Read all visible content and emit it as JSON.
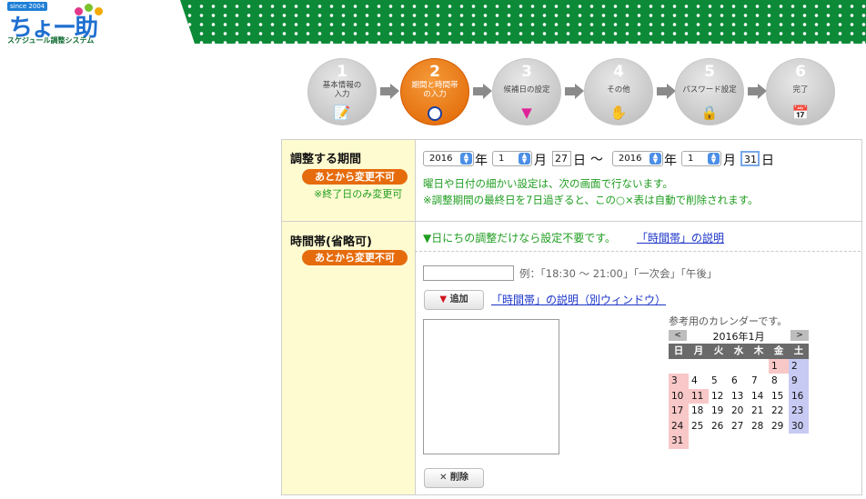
{
  "header": {
    "since": "since 2004",
    "logo_text": "ちょー助",
    "logo_sub": "スケジュール調整システム"
  },
  "steps": [
    {
      "num": "1",
      "label": "基本情報の入力",
      "icon": "document-icon",
      "active": false
    },
    {
      "num": "2",
      "label": "期間と時間帯の入力",
      "icon": "clock-icon",
      "active": true
    },
    {
      "num": "3",
      "label": "候補日の設定",
      "icon": "marker-icon",
      "active": false
    },
    {
      "num": "4",
      "label": "その他",
      "icon": "hand-icon",
      "active": false
    },
    {
      "num": "5",
      "label": "パスワード設定",
      "icon": "lock-icon",
      "active": false
    },
    {
      "num": "6",
      "label": "完了",
      "icon": "calendar-check-icon",
      "active": false
    }
  ],
  "period": {
    "label": "調整する期間",
    "badge": "あとから変更不可",
    "note_end_only": "※終了日のみ変更可",
    "start_year": "2016",
    "year_char": "年",
    "start_month": "1",
    "month_char": "月",
    "start_day": "27",
    "day_char": "日",
    "tilde": "〜",
    "end_year": "2016",
    "end_month": "1",
    "end_day": "31",
    "info1": "曜日や日付の細かい設定は、次の画面で行ないます。",
    "info2": "※調整期間の最終日を7日過ぎると、この○×表は自動で削除されます。"
  },
  "timeslot": {
    "label": "時間帯(省略可)",
    "badge": "あとから変更不可",
    "hint": "▼日にちの調整だけなら設定不要です。",
    "hint_link": "「時間帯」の説明",
    "example": "例：「18:30 〜 21:00」「一次会」「午後」",
    "add_label": "▼ 追加",
    "help_link": "「時間帯」の説明（別ウィンドウ）",
    "delete_label": "✕ 削除",
    "input_value": ""
  },
  "calendar": {
    "caption": "参考用のカレンダーです。",
    "prev": "<",
    "next": ">",
    "month": "2016年1月",
    "weekdays": [
      "日",
      "月",
      "火",
      "水",
      "木",
      "金",
      "土"
    ],
    "weeks": [
      [
        "",
        "",
        "",
        "",
        "",
        "1",
        "2"
      ],
      [
        "3",
        "4",
        "5",
        "6",
        "7",
        "8",
        "9"
      ],
      [
        "10",
        "11",
        "12",
        "13",
        "14",
        "15",
        "16"
      ],
      [
        "17",
        "18",
        "19",
        "20",
        "21",
        "22",
        "23"
      ],
      [
        "24",
        "25",
        "26",
        "27",
        "28",
        "29",
        "30"
      ],
      [
        "31",
        "",
        "",
        "",
        "",
        "",
        ""
      ]
    ],
    "holidays": [
      "1",
      "11"
    ],
    "colors": {
      "sunday": "#f8c7c7",
      "saturday": "#c7caf3",
      "header": "#6a6a6a"
    }
  },
  "colors": {
    "accent_orange": "#e66b0c",
    "banner_green": "#0c8a37",
    "note_green": "#1f9d20",
    "link_blue": "#1a33c8"
  }
}
